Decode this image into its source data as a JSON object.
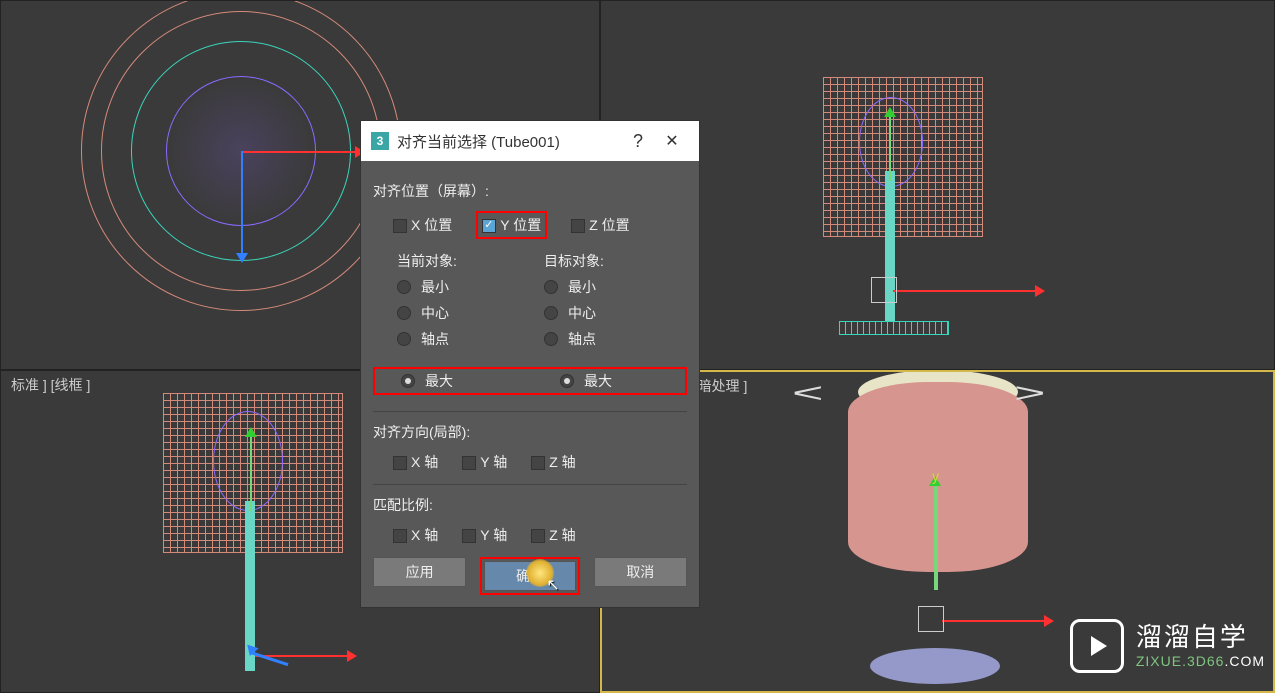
{
  "viewports": {
    "bottom_left_label": "标准 ] [线框 ]",
    "bottom_right_label": "标准 ] [默认明暗处理 ]"
  },
  "dialog": {
    "app_icon_text": "3",
    "title": "对齐当前选择 (Tube001)",
    "help": "?",
    "close_symbol": "✕",
    "align_position_label": "对齐位置（屏幕）:",
    "pos_x": "X 位置",
    "pos_y": "Y 位置",
    "pos_z": "Z 位置",
    "current_object": "当前对象:",
    "target_object": "目标对象:",
    "opt_min": "最小",
    "opt_center": "中心",
    "opt_pivot": "轴点",
    "opt_max": "最大",
    "align_orient_label": "对齐方向(局部):",
    "axis_x": "X 轴",
    "axis_y": "Y 轴",
    "axis_z": "Z 轴",
    "match_scale_label": "匹配比例:",
    "btn_apply": "应用",
    "btn_ok": "确定",
    "btn_cancel": "取消"
  },
  "watermark": {
    "brand": "溜溜自学",
    "url_prefix": "ZIXUE.",
    "url_domain": "3D66",
    "url_suffix": ".COM"
  }
}
